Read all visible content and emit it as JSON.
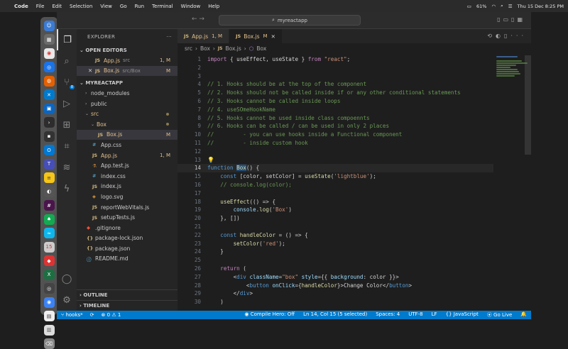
{
  "menubar": {
    "app": "Code",
    "items": [
      "File",
      "Edit",
      "Selection",
      "View",
      "Go",
      "Run",
      "Terminal",
      "Window",
      "Help"
    ],
    "battery": "61%",
    "datetime": "Thu 15 Dec 8:25 PM"
  },
  "title": {
    "search": "myreactapp"
  },
  "explorer": {
    "header": "EXPLORER",
    "open_editors_title": "OPEN EDITORS",
    "open_editors": [
      {
        "name": "App.js",
        "path": "src",
        "status": "1, M"
      },
      {
        "name": "Box.js",
        "path": "src/Box",
        "status": "M"
      }
    ],
    "project_title": "MYREACTAPP",
    "tree": [
      {
        "name": "node_modules",
        "kind": "folder"
      },
      {
        "name": "public",
        "kind": "folder"
      },
      {
        "name": "src",
        "kind": "folder-open"
      },
      {
        "name": "Box",
        "kind": "folder-open"
      },
      {
        "name": "Box.js",
        "kind": "js",
        "status": "M"
      },
      {
        "name": "App.css",
        "kind": "css"
      },
      {
        "name": "App.js",
        "kind": "js",
        "status": "1, M"
      },
      {
        "name": "App.test.js",
        "kind": "js"
      },
      {
        "name": "index.css",
        "kind": "css"
      },
      {
        "name": "index.js",
        "kind": "js"
      },
      {
        "name": "logo.svg",
        "kind": "svg"
      },
      {
        "name": "reportWebVitals.js",
        "kind": "js"
      },
      {
        "name": "setupTests.js",
        "kind": "js"
      },
      {
        "name": ".gitignore",
        "kind": "git"
      },
      {
        "name": "package-lock.json",
        "kind": "json"
      },
      {
        "name": "package.json",
        "kind": "json"
      },
      {
        "name": "README.md",
        "kind": "md"
      }
    ],
    "outline": "OUTLINE",
    "timeline": "TIMELINE"
  },
  "tabs": [
    {
      "name": "App.js",
      "badge": "1, M"
    },
    {
      "name": "Box.js",
      "badge": "M"
    }
  ],
  "breadcrumb": [
    "src",
    "Box",
    "Box.js",
    "Box"
  ],
  "code_lines": [
    "import { useEffect, useState } from \"react\";",
    "",
    "",
    "// 1. Hooks should be at the top of the component",
    "// 2. Hooks should not be called inside if or any other conditional statements",
    "// 3. Hooks cannot be called inside loops",
    "// 4. useSOmeHookName",
    "// 5. Hooks cannot be used inside class compoennts",
    "// 6. Hooks can be called / can be used in only 2 places",
    "//         - you can use hooks inside a Functional component",
    "//         - inside custom hook",
    "",
    "",
    "function Box() {",
    "    const [color, setColor] = useState('lightblue');",
    "    // console.log(color);",
    "",
    "    useEffect(() => {",
    "        console.log('Box')",
    "    }, [])",
    "",
    "    const handleColor = () => {",
    "        setColor('red');",
    "    }",
    "",
    "    return (",
    "        <div className=\"box\" style={{ background: color }}>",
    "            <button onClick={handleColor}>Change Color</button>",
    "        </div>",
    "    )"
  ],
  "status": {
    "branch": "hooks*",
    "problems": "0",
    "warnings": "1",
    "compile_hero": "Compile Hero: Off",
    "position": "Ln 14, Col 15 (5 selected)",
    "spaces": "Spaces: 4",
    "encoding": "UTF-8",
    "eol": "LF",
    "language": "JavaScript",
    "golive": "Go Live"
  }
}
